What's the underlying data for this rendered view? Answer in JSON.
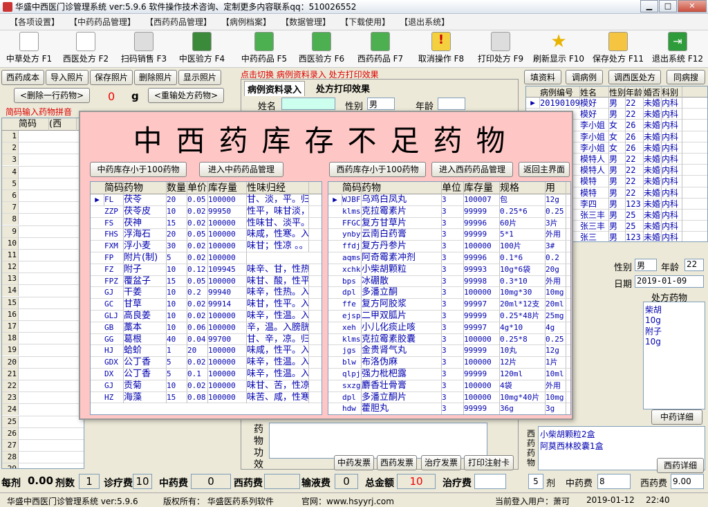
{
  "window": {
    "title": "华盛中西医门诊管理系统 ver:5.9.6    软件操作技术咨询、定制更多内容联系qq：510026552"
  },
  "menu": [
    "【各项设置】",
    "【中药药品管理】",
    "【西药药品管理】",
    "【病例档案】",
    "【数据管理】",
    "【下载使用】",
    "【退出系统】"
  ],
  "toolbar": [
    {
      "label": "中草处方 F1",
      "icon": "document-icon"
    },
    {
      "label": "西医处方 F2",
      "icon": "document-icon"
    },
    {
      "label": "扫码销售 F3",
      "icon": "printer-icon"
    },
    {
      "label": "中医验方 F4",
      "icon": "book-icon"
    },
    {
      "label": "中药药品 F5",
      "icon": "basket-icon"
    },
    {
      "label": "西医验方 F6",
      "icon": "basket-icon"
    },
    {
      "label": "西药药品 F7",
      "icon": "basket-icon"
    },
    {
      "label": "取消操作 F8",
      "icon": "warning-icon"
    },
    {
      "label": "打印处方 F9",
      "icon": "printer-icon"
    },
    {
      "label": "刷新显示 F10",
      "icon": "star-icon"
    },
    {
      "label": "保存处方 F11",
      "icon": "upload-folder-icon"
    },
    {
      "label": "退出系统 F12",
      "icon": "exit-icon"
    }
  ],
  "left": {
    "tabs": [
      "西药成本",
      "导入照片",
      "保存照片",
      "删除照片",
      "显示照片"
    ],
    "delete_row": "<删除一行药物>",
    "qty": "0",
    "unit": "g",
    "reinput": "<重输处方药物>",
    "hint": "简码输入药物拼音",
    "col_code": "简码",
    "col_name": "(西",
    "rows": [
      "1",
      "2",
      "3",
      "4",
      "5",
      "6",
      "7",
      "8",
      "9",
      "10",
      "11",
      "12",
      "13",
      "14",
      "15",
      "16",
      "17",
      "18",
      "19",
      "20",
      "21",
      "22",
      "23",
      "24",
      "25",
      "26",
      "27",
      "28",
      "29"
    ]
  },
  "middle": {
    "switch_hint": "点击切换  病例资料录入  处方打印效果",
    "tab1": "病例资料录入",
    "tab2": "处方打印效果",
    "name_lbl": "姓名",
    "sex_lbl": "性别",
    "sex_val": "男",
    "age_lbl": "年龄",
    "side": "药物功效",
    "bottom_btns": [
      "中药发票",
      "西药发票",
      "治疗发票",
      "打印注射卡"
    ]
  },
  "right": {
    "buttons": [
      "填资料",
      "调病例",
      "调西医处方",
      "同病搜"
    ],
    "headers": [
      "病例编号",
      "姓名",
      "性别",
      "年龄",
      "婚否",
      "科别"
    ],
    "rows": [
      [
        "20190109",
        "模好",
        "男",
        "22",
        "未婚",
        "内科"
      ],
      [
        "",
        "模好",
        "男",
        "22",
        "未婚",
        "内科"
      ],
      [
        "",
        "李小姐",
        "女",
        "26",
        "未婚",
        "内科"
      ],
      [
        "",
        "李小姐",
        "女",
        "26",
        "未婚",
        "内科"
      ],
      [
        "",
        "李小姐",
        "女",
        "26",
        "未婚",
        "内科"
      ],
      [
        "",
        "模特人",
        "男",
        "22",
        "未婚",
        "内科"
      ],
      [
        "",
        "模特人",
        "男",
        "22",
        "未婚",
        "内科"
      ],
      [
        "",
        "模特",
        "男",
        "22",
        "未婚",
        "内科"
      ],
      [
        "",
        "模特",
        "男",
        "22",
        "未婚",
        "内科"
      ],
      [
        "",
        "李四",
        "男",
        "123",
        "未婚",
        "内科"
      ],
      [
        "",
        "张三丰",
        "男",
        "25",
        "未婚",
        "内科"
      ],
      [
        "",
        "张三丰",
        "男",
        "25",
        "未婚",
        "内科"
      ],
      [
        "",
        "张三",
        "男",
        "123",
        "未婚",
        "内科"
      ]
    ],
    "sex_lbl": "性别",
    "sex_val": "男",
    "age_lbl": "年龄",
    "age_val": "22",
    "date_lbl": "日期",
    "date_val": "2019-01-09",
    "rx_title": "处方药物",
    "rx_text": "柴胡\n10g\n附子\n10g",
    "herb_detail": "中药详细",
    "wm_label": "西药药物",
    "wm_text": "小柴胡颗粒2盒\n阿莫西林胶囊1盒",
    "wm_detail": "西药详细"
  },
  "modal": {
    "title": "中西药库存不足药物",
    "btn_cn_low": "中药库存小于100药物",
    "btn_cn_mgmt": "进入中药药品管理",
    "btn_wm_low": "西药库存小于100药物",
    "btn_wm_mgmt": "进入西药药品管理",
    "btn_back": "返回主界面",
    "cn_headers": [
      "简码",
      "药物",
      "数量",
      "单价",
      "库存量",
      "性味归经"
    ],
    "cn_rows": [
      [
        "FL",
        "茯苓",
        "20",
        "0.05",
        "100000",
        "甘、淡，平。归"
      ],
      [
        "ZZP",
        "茯苓皮",
        "10",
        "0.02",
        "99950",
        "性平，味甘淡，"
      ],
      [
        "FS",
        "茯神",
        "15",
        "0.02",
        "100000",
        "性味甘、淡平。"
      ],
      [
        "FHS",
        "浮海石",
        "20",
        "0.05",
        "100000",
        "味咸，性寒。入"
      ],
      [
        "FXM",
        "浮小麦",
        "30",
        "0.02",
        "100000",
        "味甘；性凉 。。"
      ],
      [
        "FP",
        "附片(制)",
        "5",
        "0.02",
        "100000",
        ""
      ],
      [
        "FZ",
        "附子",
        "10",
        "0.12",
        "109945",
        "味辛、甘，性热"
      ],
      [
        "FPZ",
        "覆盆子",
        "15",
        "0.05",
        "100000",
        "味甘、酸，性平"
      ],
      [
        "GJ",
        "干姜",
        "10",
        "0.2",
        "99940",
        "味辛，性热。入"
      ],
      [
        "GC",
        "甘草",
        "10",
        "0.02",
        "99914",
        "味甘，性平。入"
      ],
      [
        "GLJ",
        "高良姜",
        "10",
        "0.02",
        "100000",
        "味辛，性温。入"
      ],
      [
        "GB",
        "藁本",
        "10",
        "0.06",
        "100000",
        "辛，温。入膀胱"
      ],
      [
        "GG",
        "葛根",
        "40",
        "0.04",
        "99700",
        "甘、辛，凉。归"
      ],
      [
        "HJ",
        "蛤蚧",
        "1",
        "20",
        "100000",
        "味咸，性平。入"
      ],
      [
        "GDX",
        "公丁香",
        "5",
        "0.02",
        "100000",
        "味辛，性温。入"
      ],
      [
        "DX",
        "公丁香",
        "5",
        "0.1",
        "100000",
        "味辛，性温。入"
      ],
      [
        "GJ",
        "贡菊",
        "10",
        "0.02",
        "100000",
        "味甘、苦，性凉"
      ],
      [
        "HZ",
        "海藻",
        "15",
        "0.08",
        "100000",
        "味苦、咸，性寒"
      ]
    ],
    "wm_headers": [
      "简码",
      "药物",
      "单位",
      "库存量",
      "规格",
      "用"
    ],
    "wm_rows": [
      [
        "WJBF",
        "乌鸡白凤丸",
        "3",
        "100007",
        "包",
        "12g"
      ],
      [
        "klms",
        "克拉霉素片",
        "3",
        "99999",
        "0.25*6",
        "0.25"
      ],
      [
        "FFGC",
        "复方甘草片",
        "3",
        "99996",
        "60片",
        "3片"
      ],
      [
        "ynby",
        "云南白药膏",
        "3",
        "99999",
        "5*1",
        "外用"
      ],
      [
        "ffdj",
        "复方丹参片",
        "3",
        "100000",
        "100片",
        "3#"
      ],
      [
        "aqms",
        "阿奇霉素冲剂",
        "3",
        "99996",
        "0.1*6",
        "0.2"
      ],
      [
        "xchk",
        "小柴胡颗粒",
        "3",
        "99993",
        "10g*6袋",
        "20g"
      ],
      [
        "bps",
        "冰硼散",
        "3",
        "99998",
        "0.3*10",
        "外用"
      ],
      [
        "dpl",
        "多潘立酮",
        "3",
        "100000",
        "10mg*30",
        "10mg"
      ],
      [
        "ffe",
        "复方阿胶浆",
        "3",
        "99997",
        "20ml*12支",
        "20ml"
      ],
      [
        "ejsp",
        "二甲双胍片",
        "3",
        "99999",
        "0.25*48片",
        "25mg"
      ],
      [
        "xeh",
        "小儿化痰止咳",
        "3",
        "99997",
        "4g*10",
        "4g"
      ],
      [
        "klms",
        "克拉霉素胶囊",
        "3",
        "100000",
        "0.25*8",
        "0.25"
      ],
      [
        "jgs",
        "金贵肾气丸",
        "3",
        "99999",
        "10丸",
        "12g"
      ],
      [
        "blw",
        "布洛伪麻",
        "3",
        "100000",
        "12片",
        "1片"
      ],
      [
        "qlpj",
        "强力枇杷露",
        "3",
        "99999",
        "120ml",
        "10ml"
      ],
      [
        "sxzg",
        "麝香壮骨膏",
        "3",
        "100000",
        "4袋",
        "外用"
      ],
      [
        "dpl",
        "多潘立酮片",
        "3",
        "100000",
        "10mg*40片",
        "10mg"
      ],
      [
        "hdw",
        "藿胆丸",
        "3",
        "99999",
        "36g",
        "3g"
      ]
    ]
  },
  "bottom": {
    "per_dose_lbl": "每剂",
    "per_dose_val": "0.00",
    "doses_lbl": "剂数",
    "doses_val": "1",
    "fee_lbl": "诊疗费",
    "fee_val": "10",
    "cn_lbl": "中药费",
    "cn_val": "0",
    "wm_lbl": "西药费",
    "wm_val": "",
    "iv_lbl": "输液费",
    "iv_val": "0",
    "total_lbl": "总金额",
    "total_val": "10",
    "treat_lbl": "治疗费",
    "treat_val": "",
    "r_doses_val": "5",
    "r_doses_lbl": "剂",
    "r_cn_lbl": "中药费",
    "r_cn_val": "8",
    "r_wm_lbl": "西药费",
    "r_wm_val": "9.00"
  },
  "footer": {
    "app": "华盛中西医门诊管理系统 ver:5.9.6",
    "copyright": "版权所有：  华盛医药系列软件",
    "site": "官网：www.hsyyrj.com",
    "user": "当前登入用户：萧可",
    "date": "2019-01-12",
    "time": "22:40"
  }
}
